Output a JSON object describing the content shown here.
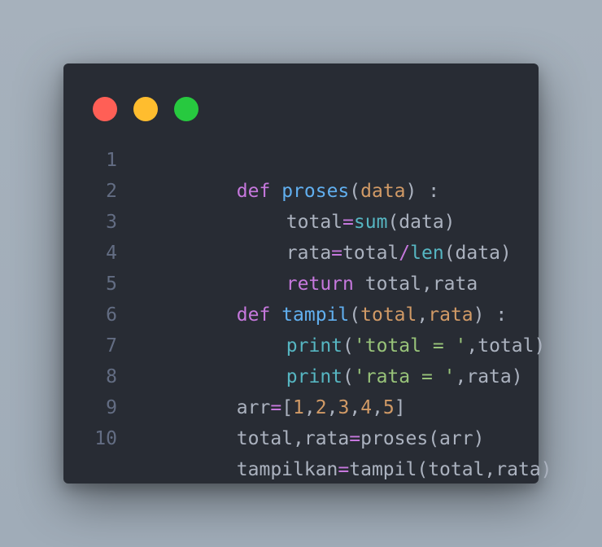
{
  "window": {
    "controls": [
      {
        "name": "close",
        "color": "#ff5f56"
      },
      {
        "name": "minimize",
        "color": "#ffbd2e"
      },
      {
        "name": "maximize",
        "color": "#27c93f"
      }
    ]
  },
  "code": {
    "language": "python",
    "lines": [
      {
        "number": "1",
        "tokens": [
          {
            "t": "def",
            "k": "kw"
          },
          {
            "t": " ",
            "k": "pl"
          },
          {
            "t": "proses",
            "k": "fn"
          },
          {
            "t": "(",
            "k": "pl"
          },
          {
            "t": "data",
            "k": "param"
          },
          {
            "t": ") :",
            "k": "pl"
          }
        ]
      },
      {
        "number": "2",
        "tokens": [
          {
            "t": "total",
            "k": "pl"
          },
          {
            "t": "=",
            "k": "op"
          },
          {
            "t": "sum",
            "k": "bi"
          },
          {
            "t": "(data)",
            "k": "pl"
          }
        ]
      },
      {
        "number": "3",
        "tokens": [
          {
            "t": "rata",
            "k": "pl"
          },
          {
            "t": "=",
            "k": "op"
          },
          {
            "t": "total",
            "k": "pl"
          },
          {
            "t": "/",
            "k": "op"
          },
          {
            "t": "len",
            "k": "bi"
          },
          {
            "t": "(data)",
            "k": "pl"
          }
        ]
      },
      {
        "number": "4",
        "tokens": [
          {
            "t": "return",
            "k": "kw"
          },
          {
            "t": " total,rata",
            "k": "pl"
          }
        ]
      },
      {
        "number": "5",
        "tokens": [
          {
            "t": "def",
            "k": "kw"
          },
          {
            "t": " ",
            "k": "pl"
          },
          {
            "t": "tampil",
            "k": "fn"
          },
          {
            "t": "(",
            "k": "pl"
          },
          {
            "t": "total",
            "k": "param"
          },
          {
            "t": ",",
            "k": "pl"
          },
          {
            "t": "rata",
            "k": "param"
          },
          {
            "t": ") :",
            "k": "pl"
          }
        ]
      },
      {
        "number": "6",
        "tokens": [
          {
            "t": "print",
            "k": "bi"
          },
          {
            "t": "(",
            "k": "pl"
          },
          {
            "t": "'total = '",
            "k": "str"
          },
          {
            "t": ",total)",
            "k": "pl"
          }
        ]
      },
      {
        "number": "7",
        "tokens": [
          {
            "t": "print",
            "k": "bi"
          },
          {
            "t": "(",
            "k": "pl"
          },
          {
            "t": "'rata = '",
            "k": "str"
          },
          {
            "t": ",rata)",
            "k": "pl"
          }
        ]
      },
      {
        "number": "8",
        "tokens": [
          {
            "t": "arr",
            "k": "pl"
          },
          {
            "t": "=",
            "k": "op"
          },
          {
            "t": "[",
            "k": "pl"
          },
          {
            "t": "1",
            "k": "num"
          },
          {
            "t": ",",
            "k": "pl"
          },
          {
            "t": "2",
            "k": "num"
          },
          {
            "t": ",",
            "k": "pl"
          },
          {
            "t": "3",
            "k": "num"
          },
          {
            "t": ",",
            "k": "pl"
          },
          {
            "t": "4",
            "k": "num"
          },
          {
            "t": ",",
            "k": "pl"
          },
          {
            "t": "5",
            "k": "num"
          },
          {
            "t": "]",
            "k": "pl"
          }
        ]
      },
      {
        "number": "9",
        "tokens": [
          {
            "t": "total,rata",
            "k": "pl"
          },
          {
            "t": "=",
            "k": "op"
          },
          {
            "t": "proses(arr)",
            "k": "pl"
          }
        ]
      },
      {
        "number": "10",
        "tokens": [
          {
            "t": "tampilkan",
            "k": "pl"
          },
          {
            "t": "=",
            "k": "op"
          },
          {
            "t": "tampil(total,rata)",
            "k": "pl"
          }
        ]
      }
    ]
  }
}
